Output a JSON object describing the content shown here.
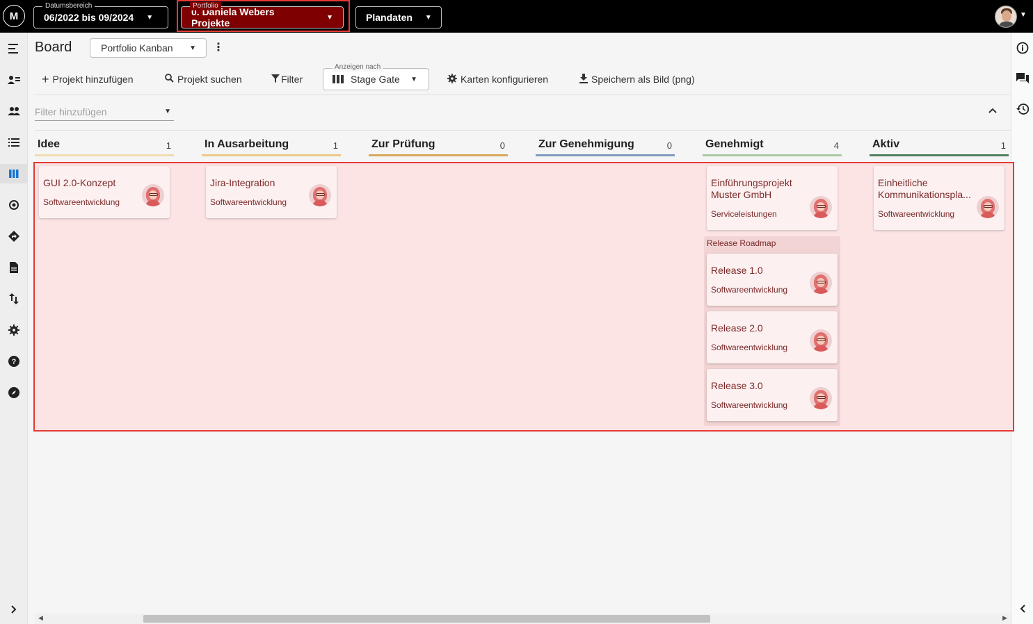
{
  "topbar": {
    "logo_text": "M",
    "date_range": {
      "label": "Datumsbereich",
      "value": "06/2022 bis 09/2024"
    },
    "portfolio": {
      "label": "Portfolio",
      "value": "0. Daniela Webers Projekte"
    },
    "plandata": {
      "value": "Plandaten"
    }
  },
  "header": {
    "title": "Board",
    "view_select": "Portfolio Kanban",
    "more": "⋮"
  },
  "toolbar": {
    "add_project": "Projekt hinzufügen",
    "search_project": "Projekt suchen",
    "filter": "Filter",
    "show_by_label": "Anzeigen nach",
    "show_by_value": "Stage Gate",
    "configure_cards": "Karten konfigurieren",
    "save_image": "Speichern als Bild (png)"
  },
  "filter": {
    "placeholder": "Filter hinzufügen"
  },
  "columns": [
    {
      "name": "Idee",
      "count": "1",
      "color": "#f1dcb0"
    },
    {
      "name": "In Ausarbeitung",
      "count": "1",
      "color": "#ecc98a"
    },
    {
      "name": "Zur Prüfung",
      "count": "0",
      "color": "#d9a85a"
    },
    {
      "name": "Zur Genehmigung",
      "count": "0",
      "color": "#7f9bbf"
    },
    {
      "name": "Genehmigt",
      "count": "4",
      "color": "#a9c9a0"
    },
    {
      "name": "Aktiv",
      "count": "1",
      "color": "#4f7f5f"
    }
  ],
  "cards": {
    "idee": {
      "title": "GUI 2.0-Konzept",
      "sub": "Softwareentwicklung"
    },
    "ausarbeitung": {
      "title": "Jira-Integration",
      "sub": "Softwareentwicklung"
    },
    "genehmigt": {
      "title": "Einführungsprojekt Muster GmbH",
      "sub": "Serviceleistungen"
    },
    "aktiv": {
      "title": "Einheitliche Kommunikationspla...",
      "sub": "Softwareentwicklung"
    }
  },
  "group": {
    "title": "Release Roadmap",
    "cards": [
      {
        "title": "Release 1.0",
        "sub": "Softwareentwicklung"
      },
      {
        "title": "Release 2.0",
        "sub": "Softwareentwicklung"
      },
      {
        "title": "Release 3.0",
        "sub": "Softwareentwicklung"
      }
    ]
  },
  "icons": {
    "sidebar": [
      "menu-open-icon",
      "user-list-icon",
      "people-icon",
      "list-icon",
      "board-icon",
      "target-icon",
      "roadmap-icon",
      "document-icon",
      "transfer-icon",
      "settings-icon",
      "help-icon",
      "compass-icon",
      "expand-icon"
    ],
    "rightbar": [
      "info-icon",
      "chat-icon",
      "history-icon",
      "collapse-left-icon"
    ]
  },
  "colors": {
    "topbar": "#000000",
    "portfolio_bg": "#7f0000",
    "highlight": "#e53935",
    "card_text": "#7a2a2a",
    "active_icon": "#1976d2"
  }
}
